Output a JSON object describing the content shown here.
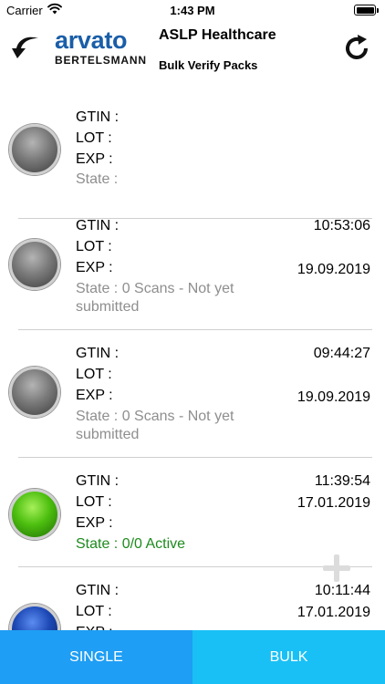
{
  "status_bar": {
    "carrier": "Carrier",
    "time": "1:43 PM"
  },
  "header": {
    "logo_brand": "arvato",
    "logo_sub": "BERTELSMANN",
    "title": "ASLP Healthcare",
    "subtitle": "Bulk Verify Packs",
    "back_icon": "curved-arrow-left-icon",
    "refresh_icon": "refresh-icon"
  },
  "labels": {
    "gtin": "GTIN :",
    "lot": "LOT :",
    "exp": "EXP :"
  },
  "packs": [
    {
      "indicator": "gray",
      "time": "",
      "date": "",
      "state": "State :"
    },
    {
      "indicator": "gray",
      "time": "10:53:06",
      "date": "19.09.2019",
      "state": "State : 0 Scans - Not yet submitted"
    },
    {
      "indicator": "gray",
      "time": "09:44:27",
      "date": "19.09.2019",
      "state": "State : 0 Scans - Not yet submitted"
    },
    {
      "indicator": "green",
      "time": "11:39:54",
      "date": "17.01.2019",
      "state": "State : 0/0 Active"
    },
    {
      "indicator": "blue",
      "time": "10:11:44",
      "date": "17.01.2019",
      "state": ""
    }
  ],
  "add_icon": "plus-icon",
  "tabs": {
    "single": "SINGLE",
    "bulk": "BULK"
  },
  "colors": {
    "brand_blue": "#1a5ea8",
    "tab_single": "#1e9ef4",
    "tab_bulk": "#19c0f5",
    "state_gray": "#8e8e8e",
    "state_active": "#1e8a1e"
  }
}
